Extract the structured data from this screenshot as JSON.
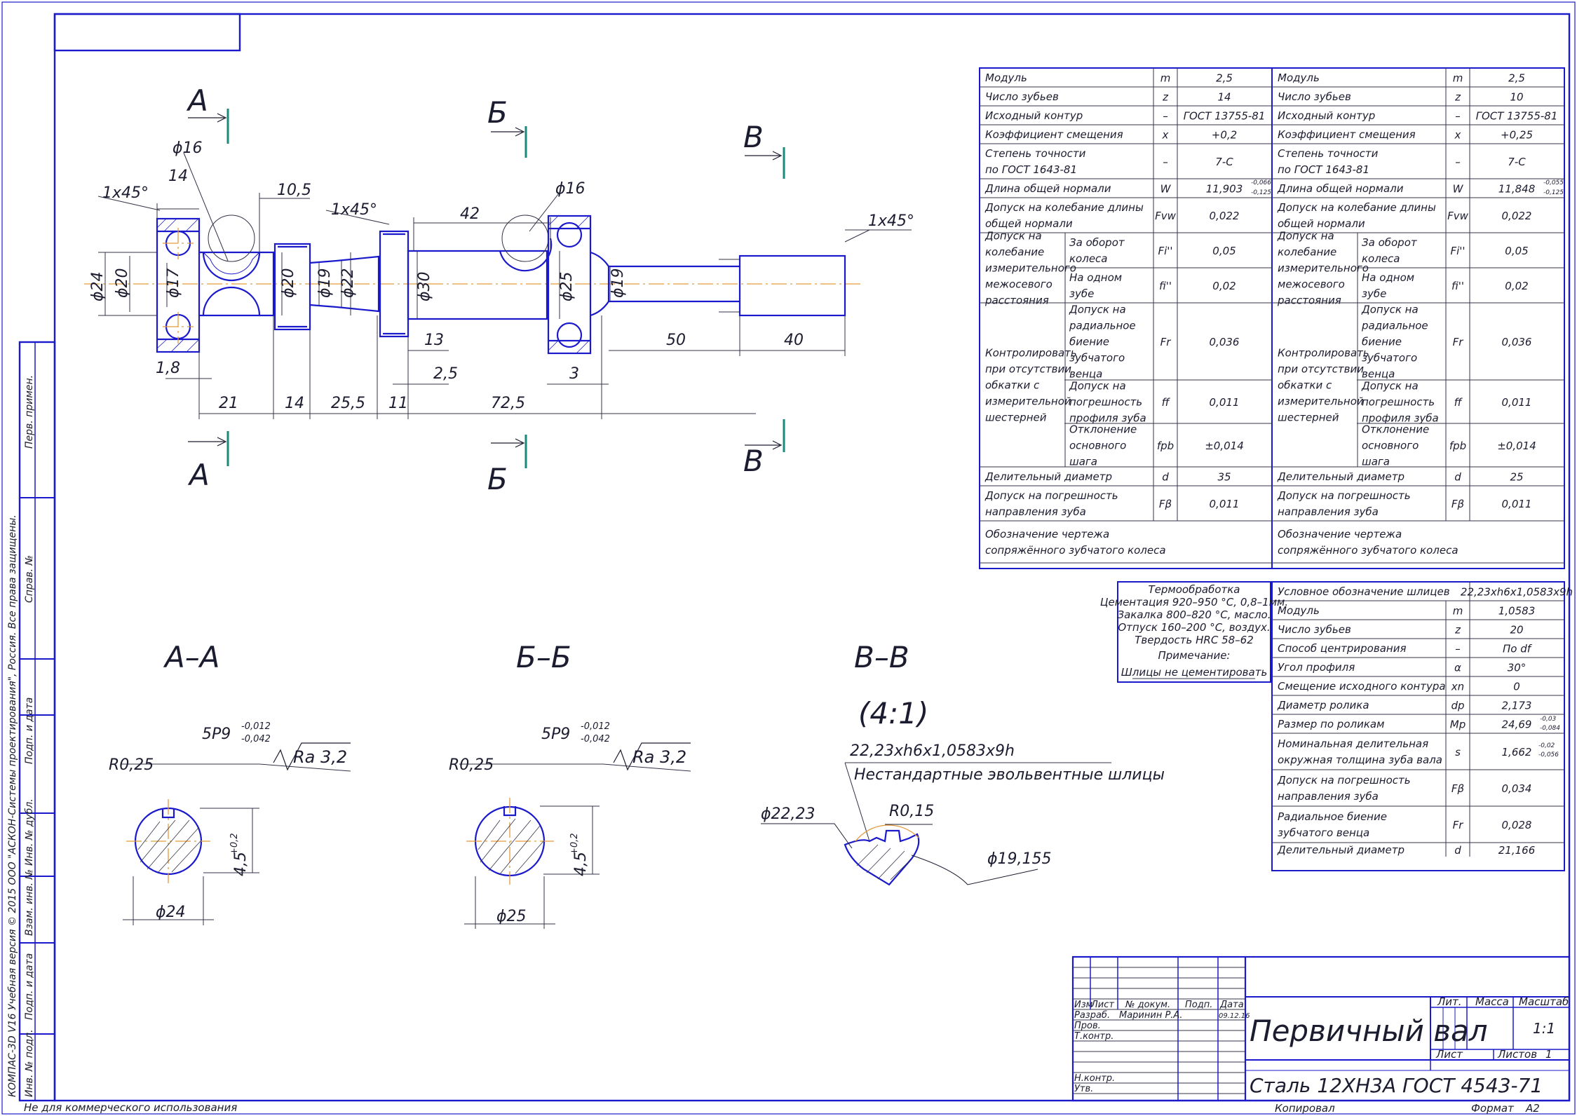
{
  "sheet": {
    "title": "Первичный вал",
    "material": "Сталь 12ХН3А ГОСТ 4543-71",
    "copy_label": "Копировал",
    "format_label": "Формат",
    "format_value": "А2",
    "noncommercial": "Не для коммерческого использования",
    "side_copyright": "КОМПАС-3D V16 Учебная версия  © 2015 ООО \"АСКОН-Системы проектирования\", Россия. Все права защищены.",
    "side_labels": [
      "Перв. примен.",
      "Справ. №",
      "Подп. и дата",
      "Инв. № дубл.",
      "Взам. инв. №",
      "Подп. и дата",
      "Инв. № подл."
    ]
  },
  "title_block": {
    "col_headers": [
      "Изм",
      "Лист",
      "№ докум.",
      "Подп.",
      "Дата"
    ],
    "rows": [
      {
        "role": "Разраб.",
        "name": "Маринин Р.А.",
        "date": "09.12.16"
      },
      {
        "role": "Пров.",
        "name": "",
        "date": ""
      },
      {
        "role": "Т.контр.",
        "name": "",
        "date": ""
      },
      {
        "role": "",
        "name": "",
        "date": ""
      },
      {
        "role": "Н.контр.",
        "name": "",
        "date": ""
      },
      {
        "role": "Утв.",
        "name": "",
        "date": ""
      }
    ],
    "lit_label": "Лит.",
    "mass_label": "Масса",
    "scale_label": "Масштаб",
    "scale_value": "1:1",
    "sheet_label": "Лист",
    "sheets_label": "Листов",
    "sheets_value": "1"
  },
  "gear_table": {
    "rows": [
      {
        "p": "Модуль",
        "s": "m",
        "v1": "2,5",
        "v2": "2,5"
      },
      {
        "p": "Число зубьев",
        "s": "z",
        "v1": "14",
        "v2": "10"
      },
      {
        "p": "Исходный контур",
        "s": "–",
        "v1": "ГОСТ 13755-81",
        "v2": "ГОСТ 13755-81"
      },
      {
        "p": "Коэффициент смещения",
        "s": "x",
        "v1": "+0,2",
        "v2": "+0,25"
      },
      {
        "p": "Степень точности|по ГОСТ 1643-81",
        "s": "–",
        "v1": "7-С",
        "v2": "7-С"
      },
      {
        "p": "Длина общей нормали",
        "s": "W",
        "v1": "11,903",
        "v2": "11,848"
      },
      {
        "p": "Допуск на колебание длины|общей нормали",
        "s": "Fvw",
        "v1": "0,022",
        "v2": "0,022"
      },
      {
        "p": "За оборот|колеса",
        "s": "Fi''",
        "v1": "0,05",
        "v2": "0,05"
      },
      {
        "p": "На одном|зубе",
        "s": "fi''",
        "v1": "0,02",
        "v2": "0,02"
      },
      {
        "p": "Допуск на|радиальное|биение|зубчатого|венца",
        "s": "Fr",
        "v1": "0,036",
        "v2": "0,036"
      },
      {
        "p": "Допуск на|погрешность|профиля зуба",
        "s": "ff",
        "v1": "0,011",
        "v2": "0,011"
      },
      {
        "p": "Отклонение|основного|шага",
        "s": "fpb",
        "v1": "±0,014",
        "v2": "±0,014"
      },
      {
        "p": "Делительный диаметр",
        "s": "d",
        "v1": "35",
        "v2": "25"
      },
      {
        "p": "Допуск на погрешность|направления зуба",
        "s": "Fβ",
        "v1": "0,011",
        "v2": "0,011"
      },
      {
        "p": "Обозначение чертежа|сопряжённого зубчатого колеса",
        "s": "",
        "v1": "",
        "v2": ""
      }
    ],
    "group1": "Допуск на|колебание|измерительного|межосевого|расстояния",
    "group2": "Контролировать|при отсутствии|обкатки с|измерительной|шестерней",
    "w1_tol": [
      "-0,066",
      "-0,125"
    ],
    "w2_tol": [
      "-0,055",
      "-0,125"
    ]
  },
  "spline_table": {
    "rows": [
      {
        "p": "Условное обозначение шлицев",
        "s": "",
        "v": "22,23xh6x1,0583x9h"
      },
      {
        "p": "Модуль",
        "s": "m",
        "v": "1,0583"
      },
      {
        "p": "Число зубьев",
        "s": "z",
        "v": "20"
      },
      {
        "p": "Способ центрирования",
        "s": "–",
        "v": "По df"
      },
      {
        "p": "Угол профиля",
        "s": "α",
        "v": "30°"
      },
      {
        "p": "Смещение исходного контура",
        "s": "xn",
        "v": "0"
      },
      {
        "p": "Диаметр ролика",
        "s": "dp",
        "v": "2,173"
      },
      {
        "p": "Размер по роликам",
        "s": "Mp",
        "v": "24,69"
      },
      {
        "p": "Номинальная делительная|окружная толщина зуба вала",
        "s": "s",
        "v": "1,662"
      },
      {
        "p": "Допуск на погрешность|направления зуба",
        "s": "Fβ",
        "v": "0,034"
      },
      {
        "p": "Радиальное биение|зубчатого венца",
        "s": "Fr",
        "v": "0,028"
      },
      {
        "p": "Делительный диаметр",
        "s": "d",
        "v": "21,166"
      }
    ],
    "mp_tol": [
      "-0,03",
      "-0,084"
    ],
    "s_tol": [
      "-0,02",
      "-0,056"
    ]
  },
  "notes": {
    "lines": [
      "Термообработка",
      "Цементация 920–950 °С, 0,8–1мм.",
      "Закалка 800–820 °С, масло.",
      "Отпуск 160–200 °С, воздух.",
      "Твердость HRC 58–62",
      "Примечание:",
      "Шлицы не цементировать"
    ]
  },
  "drawing": {
    "sections": {
      "a_letter": "А",
      "b_letter": "Б",
      "v_letter": "В"
    },
    "section_titles": {
      "aa": "А–А",
      "bb": "Б–Б",
      "vv": "В–В",
      "vv_scale": "(4:1)"
    },
    "dims": {
      "d16a": "ϕ16",
      "d16b": "ϕ16",
      "c1": "1x45°",
      "c2": "1x45°",
      "c3": "1x45°",
      "l14": "14",
      "l105": "10,5",
      "l42": "42",
      "d24": "ϕ24",
      "d20a": "ϕ20",
      "d17": "ϕ17",
      "d20b": "ϕ20",
      "d19a": "ϕ19",
      "d22": "ϕ22",
      "d30": "ϕ30",
      "d25": "ϕ25",
      "d19b": "ϕ19",
      "l18": "1,8",
      "l13": "13",
      "l50": "50",
      "l40": "40",
      "l25": "2,5",
      "l3": "3",
      "l21": "21",
      "l14b": "14",
      "l255": "25,5",
      "l11": "11",
      "l725": "72,5"
    },
    "aa": {
      "key": "5P9",
      "key_tol_up": "-0,012",
      "key_tol_lo": "-0,042",
      "ra": "Ra 3,2",
      "r": "R0,25",
      "depth": "4,5",
      "depth_tol": "+0,2",
      "dia": "ϕ24"
    },
    "bb": {
      "key": "5P9",
      "key_tol_up": "-0,012",
      "key_tol_lo": "-0,042",
      "ra": "Ra 3,2",
      "r": "R0,25",
      "depth": "4,5",
      "depth_tol": "+0,2",
      "dia": "ϕ25"
    },
    "vv": {
      "spline": "22,23xh6x1,0583x9h",
      "desc": "Нестандартные эвольвентные шлицы",
      "d1": "ϕ22,23",
      "r": "R0,15",
      "d2": "ϕ19,155"
    }
  },
  "colors": {
    "frame": "#1a1acc",
    "text": "#1c1c30",
    "axis": "#e39a3a",
    "section_mark": "#1a8a7a"
  }
}
